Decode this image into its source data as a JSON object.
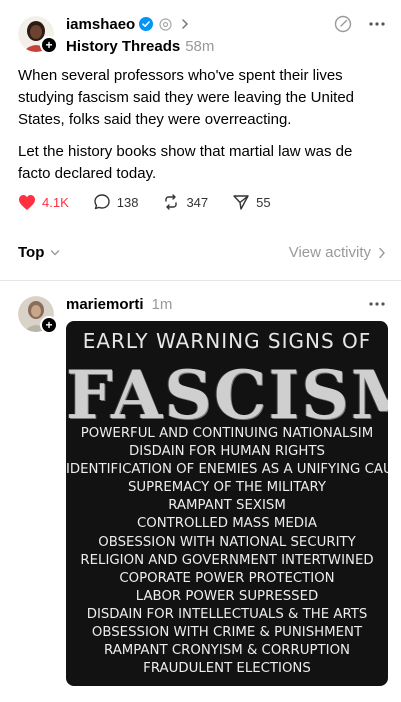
{
  "colors": {
    "like": "#ff3040",
    "muted": "#999999",
    "poster_bg": "#121212"
  },
  "post": {
    "username": "iamshaeo",
    "verified_icon": "verified-badge-icon",
    "community": "History Threads",
    "time": "58m",
    "paragraphs": [
      "When several professors who've spent their lives studying fascism said they were leaving the United States, folks said they were overreacting.",
      "Let the history books show that martial law was de facto declared today."
    ],
    "actions": {
      "likes": "4.1K",
      "comments": "138",
      "reposts": "347",
      "shares": "55"
    }
  },
  "sort": {
    "label": "Top",
    "view_activity": "View activity"
  },
  "reply": {
    "username": "mariemorti",
    "time": "1m",
    "image": {
      "title": "EARLY WARNING SIGNS OF",
      "headline": "FASCISM",
      "items": [
        "POWERFUL AND CONTINUING NATIONALSIM",
        "DISDAIN FOR HUMAN RIGHTS",
        "IDENTIFICATION OF ENEMIES AS A UNIFYING CAUSE",
        "SUPREMACY OF THE MILITARY",
        "RAMPANT SEXISM",
        "CONTROLLED MASS MEDIA",
        "OBSESSION WITH NATIONAL SECURITY",
        "RELIGION AND GOVERNMENT INTERTWINED",
        "COPORATE POWER PROTECTION",
        "LABOR POWER SUPRESSED",
        "DISDAIN FOR INTELLECTUALS & THE ARTS",
        "OBSESSION WITH CRIME & PUNISHMENT",
        "RAMPANT CRONYISM & CORRUPTION",
        "FRAUDULENT ELECTIONS"
      ]
    }
  }
}
